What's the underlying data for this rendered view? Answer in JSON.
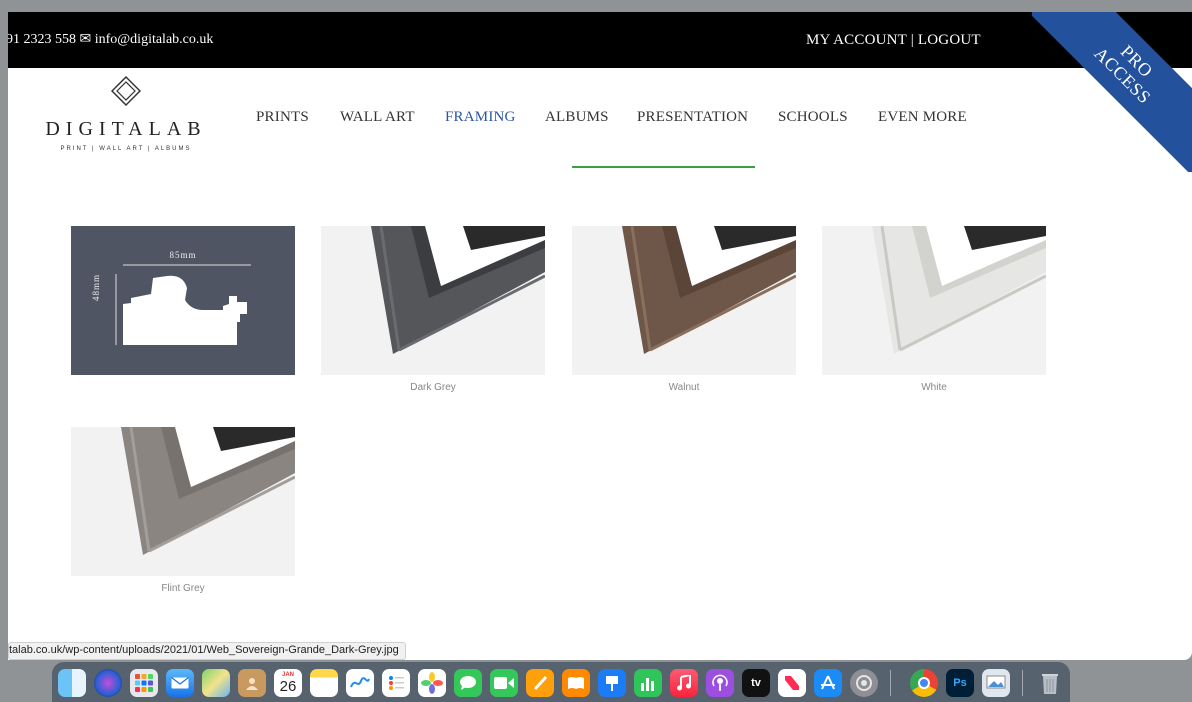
{
  "topbar": {
    "contact": "91 2323 558 ✉ info@digitalab.co.uk",
    "my_account": "MY ACCOUNT",
    "separator": " | ",
    "logout": "LOGOUT",
    "ribbon_line1": "PRO",
    "ribbon_line2": "ACCESS"
  },
  "logo": {
    "name": "DIGITALAB",
    "tagline": "PRINT | WALL ART | ALBUMS"
  },
  "nav": {
    "items": [
      "PRINTS",
      "WALL ART",
      "FRAMING",
      "ALBUMS",
      "PRESENTATION",
      "SCHOOLS",
      "EVEN MORE"
    ],
    "active": "FRAMING",
    "active_color": "#2b57a7",
    "underline_color": "#3aa03a"
  },
  "profile": {
    "width_label": "85mm",
    "height_label": "48mm",
    "background": "#4f5563"
  },
  "swatches": [
    {
      "caption": "Dark Grey",
      "color": "#55565a"
    },
    {
      "caption": "Walnut",
      "color": "#6e5748"
    },
    {
      "caption": "White",
      "color": "#e6e6e4"
    },
    {
      "caption": "Flint Grey",
      "color": "#8a8580"
    }
  ],
  "status_url": "talab.co.uk/wp-content/uploads/2021/01/Web_Sovereign-Grande_Dark-Grey.jpg",
  "dock": {
    "calendar_month": "JAN",
    "calendar_day": "26",
    "tv_label": "tv",
    "ps_label": "Ps",
    "icons": [
      "finder-icon",
      "siri-icon",
      "launchpad-icon",
      "mail-icon",
      "maps-icon",
      "contacts-icon",
      "calendar-icon",
      "notes-icon",
      "freeform-icon",
      "reminders-icon",
      "photos-icon",
      "messages-icon",
      "facetime-icon",
      "pages-icon",
      "books-icon",
      "keynote-icon",
      "numbers-icon",
      "music-icon",
      "podcasts-icon",
      "apple-tv-icon",
      "news-icon",
      "app-store-icon",
      "system-settings-icon",
      "chrome-icon",
      "photoshop-icon",
      "preview-icon",
      "trash-icon"
    ]
  }
}
